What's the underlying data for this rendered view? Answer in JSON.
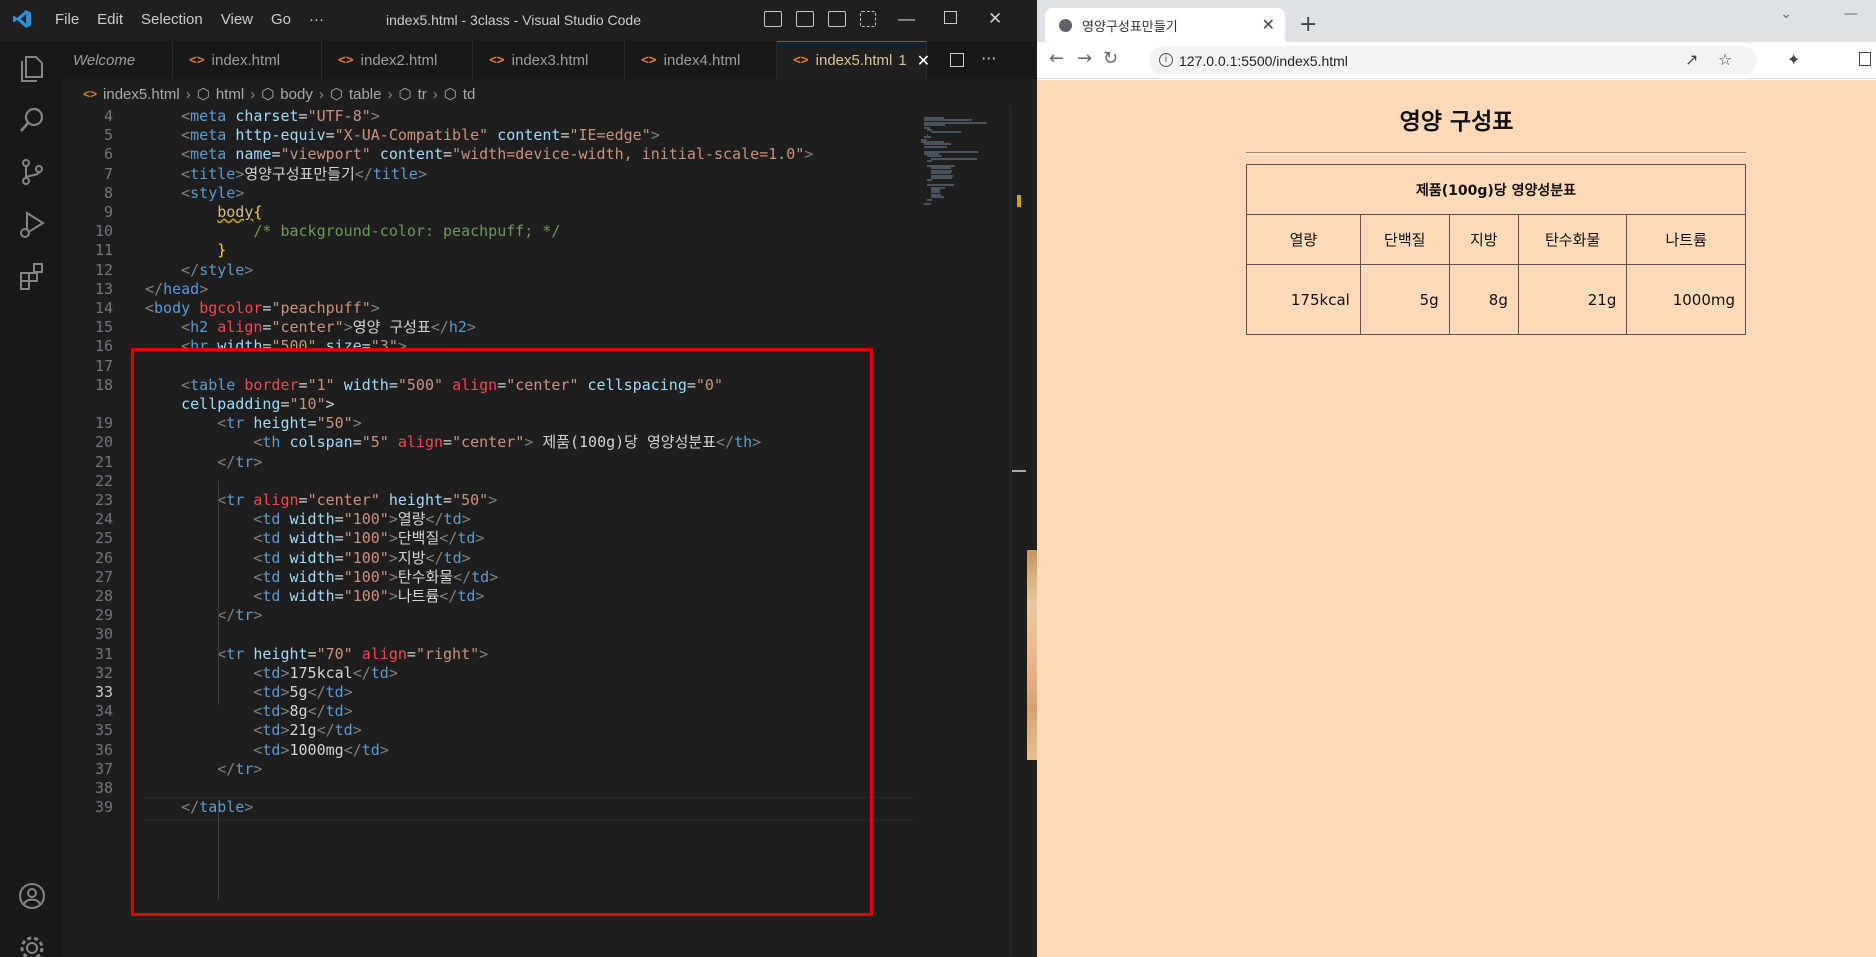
{
  "vscode": {
    "menu": [
      "File",
      "Edit",
      "Selection",
      "View",
      "Go",
      "···"
    ],
    "window_title": "index5.html - 3class - Visual Studio Code",
    "tabs": [
      {
        "label": "Welcome",
        "icon": "vscode-icon",
        "active": false
      },
      {
        "label": "index.html",
        "icon": "html-icon",
        "active": false
      },
      {
        "label": "index2.html",
        "icon": "html-icon",
        "active": false
      },
      {
        "label": "index3.html",
        "icon": "html-icon",
        "active": false
      },
      {
        "label": "index4.html",
        "icon": "html-icon",
        "active": false
      },
      {
        "label": "index5.html",
        "icon": "html-icon",
        "active": true,
        "badge": "1"
      }
    ],
    "breadcrumb": [
      "index5.html",
      "html",
      "body",
      "table",
      "tr",
      "td"
    ],
    "code_lines": [
      {
        "n": 4,
        "text": "    <meta charset=\"UTF-8\">"
      },
      {
        "n": 5,
        "text": "    <meta http-equiv=\"X-UA-Compatible\" content=\"IE=edge\">"
      },
      {
        "n": 6,
        "text": "    <meta name=\"viewport\" content=\"width=device-width, initial-scale=1.0\">"
      },
      {
        "n": 7,
        "text": "    <title>영양구성표만들기</title>"
      },
      {
        "n": 8,
        "text": "    <style>"
      },
      {
        "n": 9,
        "text": "        body{"
      },
      {
        "n": 10,
        "text": "            /* background-color: peachpuff; */"
      },
      {
        "n": 11,
        "text": "        }"
      },
      {
        "n": 12,
        "text": "    </style>"
      },
      {
        "n": 13,
        "text": "</head>"
      },
      {
        "n": 14,
        "text": "<body bgcolor=\"peachpuff\">"
      },
      {
        "n": 15,
        "text": "    <h2 align=\"center\">영양 구성표</h2>"
      },
      {
        "n": 16,
        "text": "    <hr width=\"500\" size=\"3\">"
      },
      {
        "n": 17,
        "text": ""
      },
      {
        "n": 18,
        "text": "    <table border=\"1\" width=\"500\" align=\"center\" cellspacing=\"0\""
      },
      {
        "n": null,
        "text": "    cellpadding=\"10\">"
      },
      {
        "n": 19,
        "text": "        <tr height=\"50\">"
      },
      {
        "n": 20,
        "text": "            <th colspan=\"5\" align=\"center\"> 제품(100g)당 영양성분표</th>"
      },
      {
        "n": 21,
        "text": "        </tr>"
      },
      {
        "n": 22,
        "text": ""
      },
      {
        "n": 23,
        "text": "        <tr align=\"center\" height=\"50\">"
      },
      {
        "n": 24,
        "text": "            <td width=\"100\">열량</td>"
      },
      {
        "n": 25,
        "text": "            <td width=\"100\">단백질</td>"
      },
      {
        "n": 26,
        "text": "            <td width=\"100\">지방</td>"
      },
      {
        "n": 27,
        "text": "            <td width=\"100\">탄수화물</td>"
      },
      {
        "n": 28,
        "text": "            <td width=\"100\">나트륨</td>"
      },
      {
        "n": 29,
        "text": "        </tr>"
      },
      {
        "n": 30,
        "text": ""
      },
      {
        "n": 31,
        "text": "        <tr height=\"70\" align=\"right\">"
      },
      {
        "n": 32,
        "text": "            <td>175kcal</td>"
      },
      {
        "n": 33,
        "text": "            <td>5g</td>",
        "current": true
      },
      {
        "n": 34,
        "text": "            <td>8g</td>"
      },
      {
        "n": 35,
        "text": "            <td>21g</td>"
      },
      {
        "n": 36,
        "text": "            <td>1000mg</td>"
      },
      {
        "n": 37,
        "text": "        </tr>"
      },
      {
        "n": 38,
        "text": ""
      },
      {
        "n": 39,
        "text": "    </table>"
      }
    ]
  },
  "browser": {
    "tab_title": "영양구성표만들기",
    "url": "127.0.0.1:5500/index5.html",
    "page": {
      "heading": "영양 구성표",
      "table_caption": "제품(100g)당 영양성분표",
      "headers": [
        "열량",
        "단백질",
        "지방",
        "탄수화물",
        "나트륨"
      ],
      "values": [
        "175kcal",
        "5g",
        "8g",
        "21g",
        "1000mg"
      ]
    },
    "background_color": "#ffdab9"
  },
  "colors": {
    "editor_bg": "#1e1e1e",
    "highlight_box": "#e00000",
    "tag": "#569cd6",
    "attribute": "#9cdcfe",
    "string": "#ce9178",
    "comment": "#6a9955"
  }
}
